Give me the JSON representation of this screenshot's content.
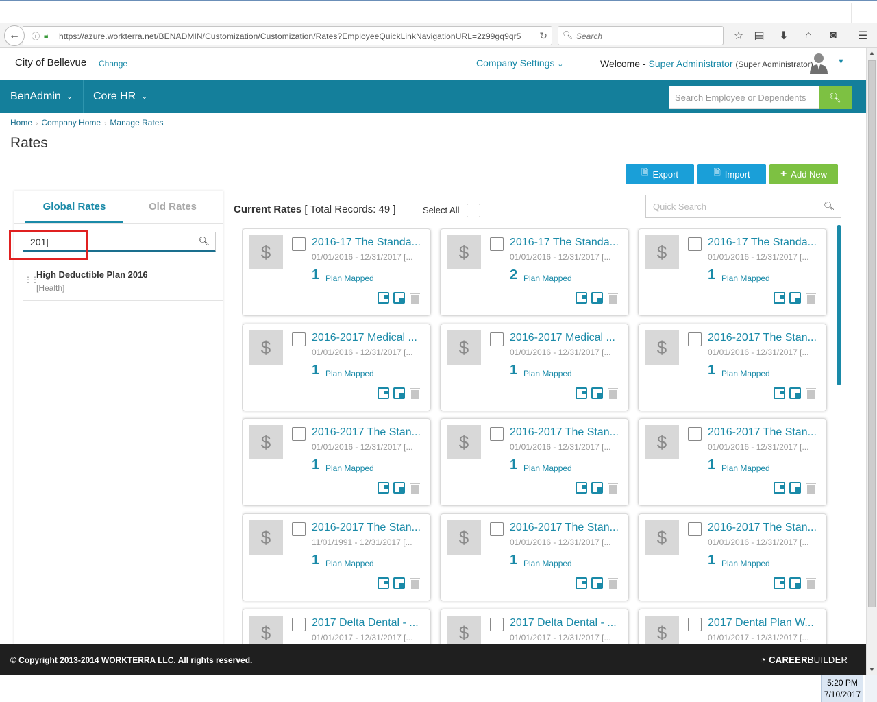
{
  "browser": {
    "url": "https://azure.workterra.net/BENADMIN/Customization/Customization/Rates?EmployeeQuickLinkNavigationURL=2z99gq9qr5",
    "search_placeholder": "Search"
  },
  "header": {
    "company": "City of Bellevue",
    "change_link": "Change",
    "company_settings": "Company Settings",
    "welcome_prefix": "Welcome -",
    "user_name": "Super Administrator",
    "user_role": "(Super Administrator)"
  },
  "nav": {
    "items": [
      {
        "label": "BenAdmin"
      },
      {
        "label": "Core HR"
      }
    ],
    "employee_search_placeholder": "Search Employee or Dependents"
  },
  "breadcrumb": [
    "Home",
    "Company Home",
    "Manage Rates"
  ],
  "page_title": "Rates",
  "actions": {
    "export": "Export",
    "import": "Import",
    "add_new": "Add New"
  },
  "left_panel": {
    "tabs": [
      "Global Rates",
      "Old Rates"
    ],
    "active_tab": "Global Rates",
    "search_value": "201|",
    "results": [
      {
        "name": "High Deductible Plan 2016",
        "type": "[Health]"
      }
    ]
  },
  "rates": {
    "heading_label": "Current Rates",
    "total_text": "[ Total Records: 49 ]",
    "select_all": "Select All",
    "quick_search_placeholder": "Quick Search",
    "plan_mapped_label": "Plan Mapped",
    "cards": [
      {
        "title": "2016-17 The Standa...",
        "dates": "01/01/2016 - 12/31/2017 [...",
        "count": "1"
      },
      {
        "title": "2016-17 The Standa...",
        "dates": "01/01/2016 - 12/31/2017 [...",
        "count": "2"
      },
      {
        "title": "2016-17 The Standa...",
        "dates": "01/01/2016 - 12/31/2017 [...",
        "count": "1"
      },
      {
        "title": "2016-2017 Medical ...",
        "dates": "01/01/2016 - 12/31/2017 [...",
        "count": "1"
      },
      {
        "title": "2016-2017 Medical ...",
        "dates": "01/01/2016 - 12/31/2017 [...",
        "count": "1"
      },
      {
        "title": "2016-2017 The Stan...",
        "dates": "01/01/2016 - 12/31/2017 [...",
        "count": "1"
      },
      {
        "title": "2016-2017 The Stan...",
        "dates": "01/01/2016 - 12/31/2017 [...",
        "count": "1"
      },
      {
        "title": "2016-2017 The Stan...",
        "dates": "01/01/2016 - 12/31/2017 [...",
        "count": "1"
      },
      {
        "title": "2016-2017 The Stan...",
        "dates": "01/01/2016 - 12/31/2017 [...",
        "count": "1"
      },
      {
        "title": "2016-2017 The Stan...",
        "dates": "11/01/1991 - 12/31/2017 [...",
        "count": "1"
      },
      {
        "title": "2016-2017 The Stan...",
        "dates": "01/01/2016 - 12/31/2017 [...",
        "count": "1"
      },
      {
        "title": "2016-2017 The Stan...",
        "dates": "01/01/2016 - 12/31/2017 [...",
        "count": "1"
      },
      {
        "title": "2017 Delta Dental - ...",
        "dates": "01/01/2017 - 12/31/2017 [...",
        "count": ""
      },
      {
        "title": "2017 Delta Dental - ...",
        "dates": "01/01/2017 - 12/31/2017 [...",
        "count": ""
      },
      {
        "title": "2017 Dental Plan W...",
        "dates": "01/01/2017 - 12/31/2017 [...",
        "count": ""
      }
    ]
  },
  "footer": {
    "copyright": "© Copyright 2013-2014 WORKTERRA LLC. All rights reserved.",
    "brand_bold": "CAREER",
    "brand_rest": "BUILDER"
  },
  "taskbar": {
    "time": "5:20 PM",
    "date": "7/10/2017"
  },
  "colors": {
    "primary_teal": "#147f9b",
    "link_blue": "#1a8aa8",
    "button_blue": "#1a9fd8",
    "button_green": "#7dc142",
    "highlight_red": "#e02020"
  }
}
